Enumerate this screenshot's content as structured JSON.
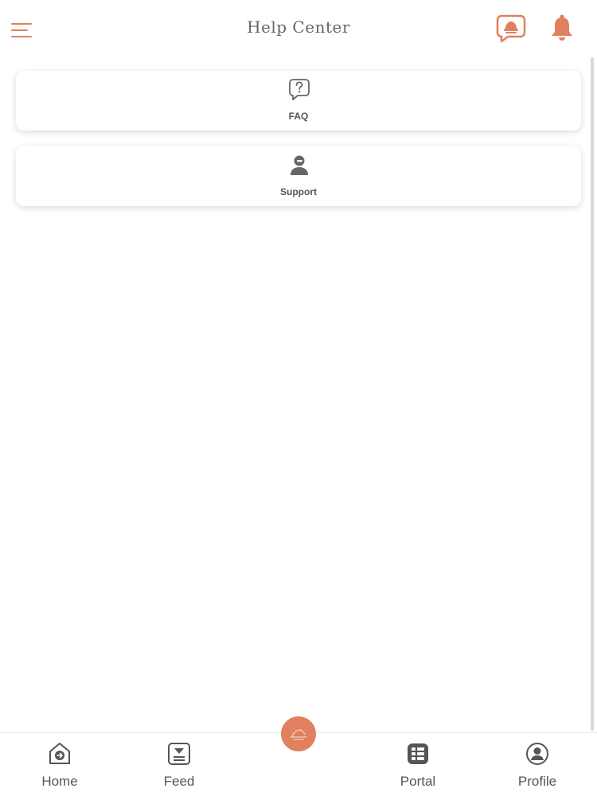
{
  "header": {
    "title": "Help Center",
    "menu_icon": "hamburger-menu-icon",
    "chat_icon": "help-chat-icon",
    "bell_icon": "notification-bell-icon"
  },
  "cards": [
    {
      "label": "FAQ",
      "icon": "question-bubble-icon"
    },
    {
      "label": "Support",
      "icon": "support-agent-icon"
    }
  ],
  "bottom_nav": {
    "items": [
      {
        "label": "Home",
        "icon": "home-icon"
      },
      {
        "label": "Feed",
        "icon": "feed-icon"
      },
      {
        "label": "Portal",
        "icon": "portal-grid-icon"
      },
      {
        "label": "Profile",
        "icon": "profile-icon"
      }
    ],
    "center_button_icon": "center-action-icon"
  },
  "colors": {
    "accent": "#e0805f",
    "text": "#555555",
    "icon_gray": "#666666"
  }
}
